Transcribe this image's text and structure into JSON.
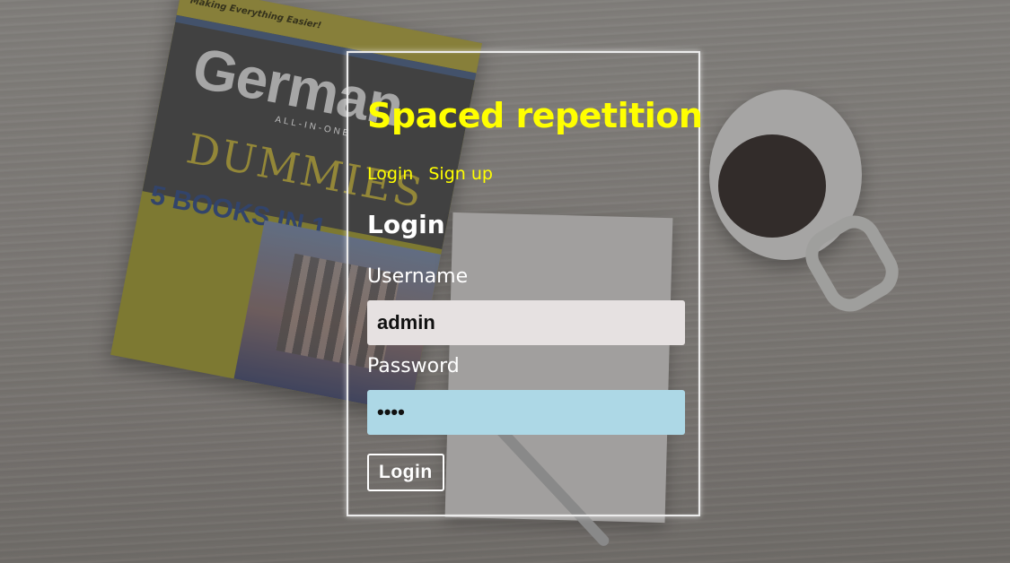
{
  "app": {
    "title": "Spaced repetition"
  },
  "nav": {
    "login_label": "Login",
    "signup_label": "Sign up"
  },
  "form": {
    "heading": "Login",
    "username_label": "Username",
    "username_value": "admin",
    "password_label": "Password",
    "password_value": "••••",
    "submit_label": "Login"
  },
  "background": {
    "book_tagline": "Making Everything Easier!",
    "book_title": "German",
    "book_subtitle": "ALL-IN-ONE",
    "book_series": "DUMMIES",
    "book_badge": "5 BOOKS IN 1"
  },
  "colors": {
    "accent": "#ffff00",
    "username_field_bg": "#e6e1e1",
    "password_field_bg": "#add8e6",
    "text_light": "#ffffff"
  }
}
